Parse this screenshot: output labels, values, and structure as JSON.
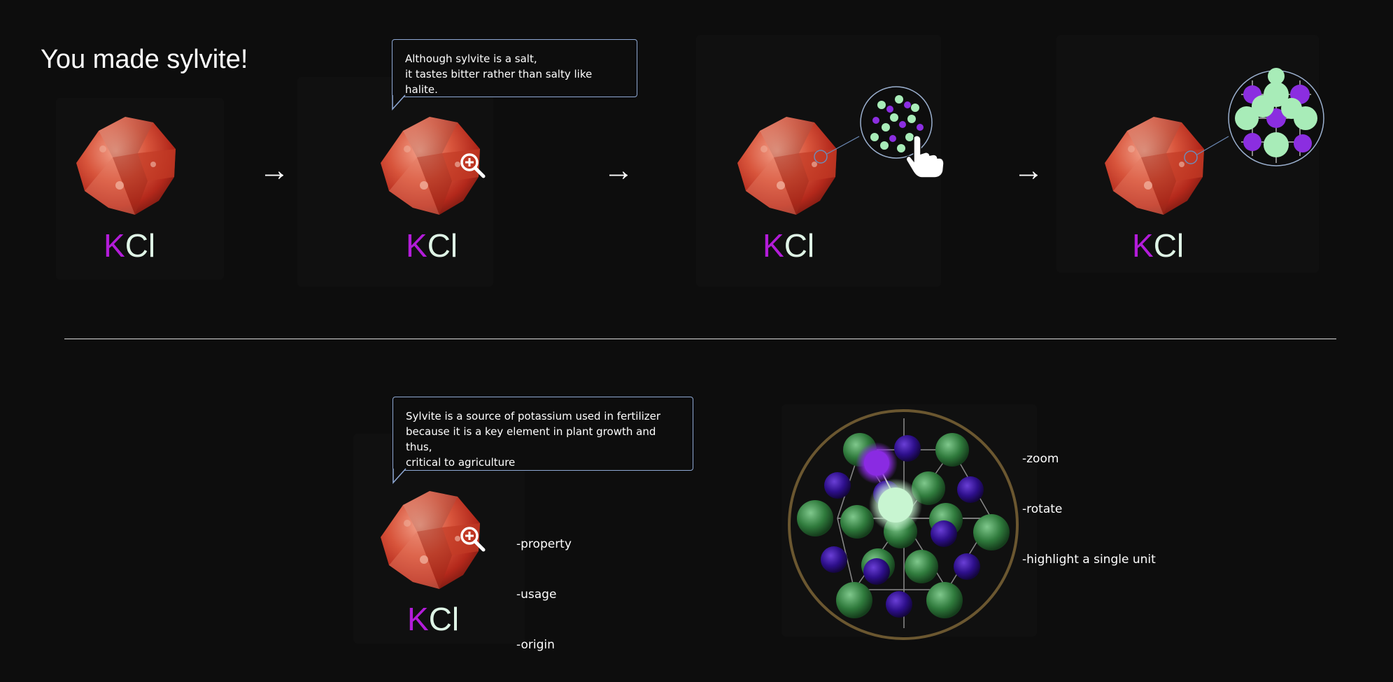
{
  "title": "You made sylvite!",
  "formula": {
    "k": "K",
    "cl": "Cl"
  },
  "steps": [
    {
      "formula": {
        "k": "K",
        "cl": "Cl"
      }
    },
    {
      "formula": {
        "k": "K",
        "cl": "Cl"
      },
      "bubble": [
        "Although sylvite is a salt,",
        "it tastes bitter rather than salty like halite."
      ]
    },
    {
      "formula": {
        "k": "K",
        "cl": "Cl"
      }
    },
    {
      "formula": {
        "k": "K",
        "cl": "Cl"
      }
    }
  ],
  "arrow_glyph": "→",
  "detail": {
    "bubble": [
      "Sylvite is a source of potassium used in fertilizer",
      "because it is a key element in plant growth and thus,",
      "critical to agriculture"
    ],
    "mineral_options": [
      "-property",
      "-usage",
      "-origin"
    ],
    "model_options": [
      "-zoom",
      "-rotate",
      "-highlight a single unit"
    ],
    "formula": {
      "k": "K",
      "cl": "Cl"
    }
  },
  "colors": {
    "background": "#0d0d0d",
    "potassium": "#b31cd9",
    "chlorine": "#dff5e6",
    "bubble_border": "#8ea8d4",
    "model_ring": "#6b5730"
  },
  "icons": [
    "magnify-plus-icon",
    "pointing-hand-icon",
    "arrow-right-icon"
  ]
}
